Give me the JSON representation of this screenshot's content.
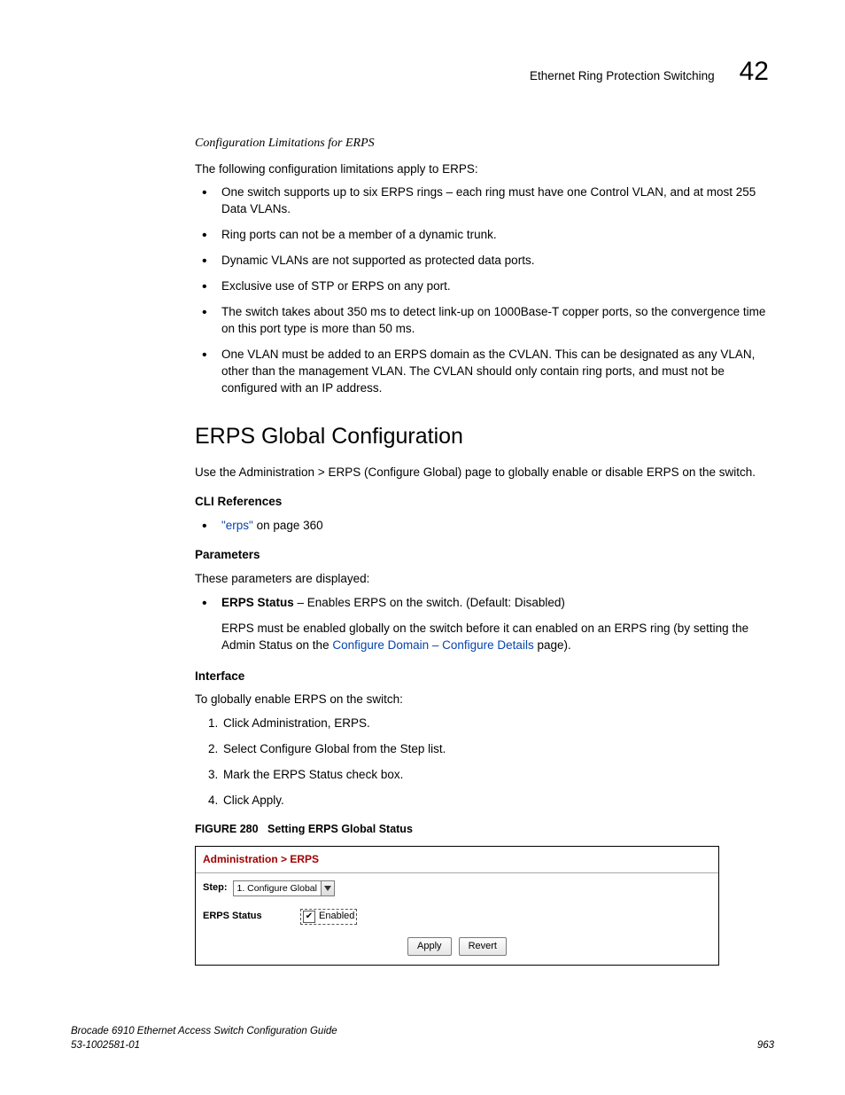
{
  "header": {
    "running_title": "Ethernet Ring Protection Switching",
    "chapter_number": "42"
  },
  "limitations": {
    "heading": "Configuration Limitations for ERPS",
    "intro": "The following configuration limitations apply to ERPS:",
    "items": [
      "One switch supports up to six ERPS rings – each ring must have one Control VLAN, and at most 255 Data VLANs.",
      "Ring ports can not be a member of a dynamic trunk.",
      "Dynamic VLANs are not supported as protected data ports.",
      "Exclusive use of STP or ERPS on any port.",
      "The switch takes about 350 ms to detect link-up on 1000Base-T copper ports, so the convergence time on this port type is more than 50 ms.",
      "One VLAN must be added to an ERPS domain as the CVLAN. This can be designated as any VLAN, other than the management VLAN. The CVLAN should only contain ring ports, and must not be configured with an IP address."
    ]
  },
  "section": {
    "title": "ERPS Global Configuration",
    "desc": "Use the Administration > ERPS (Configure Global) page to globally enable or disable ERPS on the switch.",
    "cli_label": "CLI References",
    "cli_link": "\"erps\"",
    "cli_rest": " on page 360",
    "params_label": "Parameters",
    "params_intro": "These parameters are displayed:",
    "erps_status_label": "ERPS Status",
    "erps_status_desc": " – Enables ERPS on the switch. (Default: Disabled)",
    "erps_note_pre": "ERPS must be enabled globally on the switch before it can enabled on an ERPS ring (by setting the Admin Status on the ",
    "erps_note_link": "Configure Domain – Configure Details",
    "erps_note_post": " page).",
    "interface_label": "Interface",
    "interface_intro": "To globally enable ERPS on the switch:",
    "steps": [
      "Click Administration, ERPS.",
      "Select Configure Global from the Step list.",
      "Mark the ERPS Status check box.",
      "Click Apply."
    ]
  },
  "figure": {
    "number": "FIGURE 280",
    "title": "Setting ERPS Global Status",
    "panel_title": "Administration > ERPS",
    "step_label": "Step:",
    "step_value": "1. Configure Global",
    "row_label": "ERPS Status",
    "checkbox_label": "Enabled",
    "apply": "Apply",
    "revert": "Revert"
  },
  "footer": {
    "left1": "Brocade 6910 Ethernet Access Switch Configuration Guide",
    "left2": "53-1002581-01",
    "right": "963"
  }
}
